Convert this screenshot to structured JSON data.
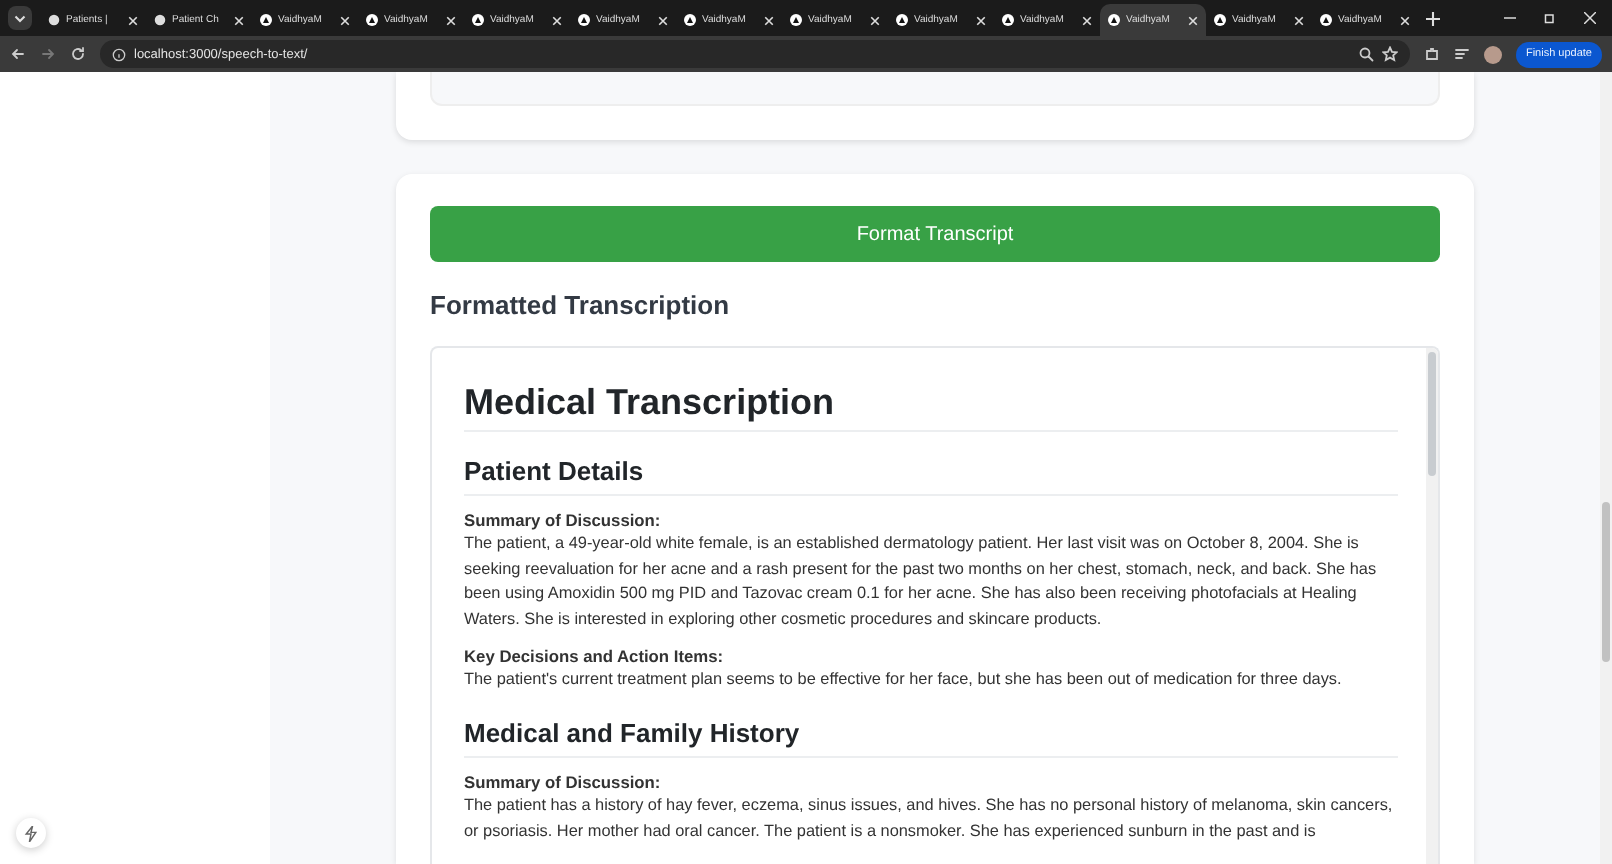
{
  "browser": {
    "tabs": [
      {
        "title": "Patients |",
        "selected": false
      },
      {
        "title": "Patient Ch",
        "selected": false
      },
      {
        "title": "VaidhyaM",
        "selected": false
      },
      {
        "title": "VaidhyaM",
        "selected": false
      },
      {
        "title": "VaidhyaM",
        "selected": false
      },
      {
        "title": "VaidhyaM",
        "selected": false
      },
      {
        "title": "VaidhyaM",
        "selected": false
      },
      {
        "title": "VaidhyaM",
        "selected": false
      },
      {
        "title": "VaidhyaM",
        "selected": false
      },
      {
        "title": "VaidhyaM",
        "selected": false
      },
      {
        "title": "VaidhyaM",
        "selected": true
      },
      {
        "title": "VaidhyaM",
        "selected": false
      },
      {
        "title": "VaidhyaM",
        "selected": false
      }
    ],
    "url": "localhost:3000/speech-to-text/",
    "update_button": "Finish update"
  },
  "page": {
    "format_button": "Format Transcript",
    "section_title": "Formatted Transcription",
    "document": {
      "title": "Medical Transcription",
      "sections": [
        {
          "heading": "Patient Details",
          "blocks": [
            {
              "label": "Summary of Discussion:",
              "text": "The patient, a 49-year-old white female, is an established dermatology patient. Her last visit was on October 8, 2004. She is seeking reevaluation for her acne and a rash present for the past two months on her chest, stomach, neck, and back. She has been using Amoxidin 500 mg PID and Tazovac cream 0.1 for her acne. She has also been receiving photofacials at Healing Waters. She is interested in exploring other cosmetic procedures and skincare products."
            },
            {
              "label": "Key Decisions and Action Items:",
              "text": "The patient's current treatment plan seems to be effective for her face, but she has been out of medication for three days."
            }
          ]
        },
        {
          "heading": "Medical and Family History",
          "blocks": [
            {
              "label": "Summary of Discussion:",
              "text": "The patient has a history of hay fever, eczema, sinus issues, and hives. She has no personal history of melanoma, skin cancers, or psoriasis. Her mother had oral cancer. The patient is a nonsmoker. She has experienced sunburn in the past and is"
            }
          ]
        }
      ]
    }
  }
}
